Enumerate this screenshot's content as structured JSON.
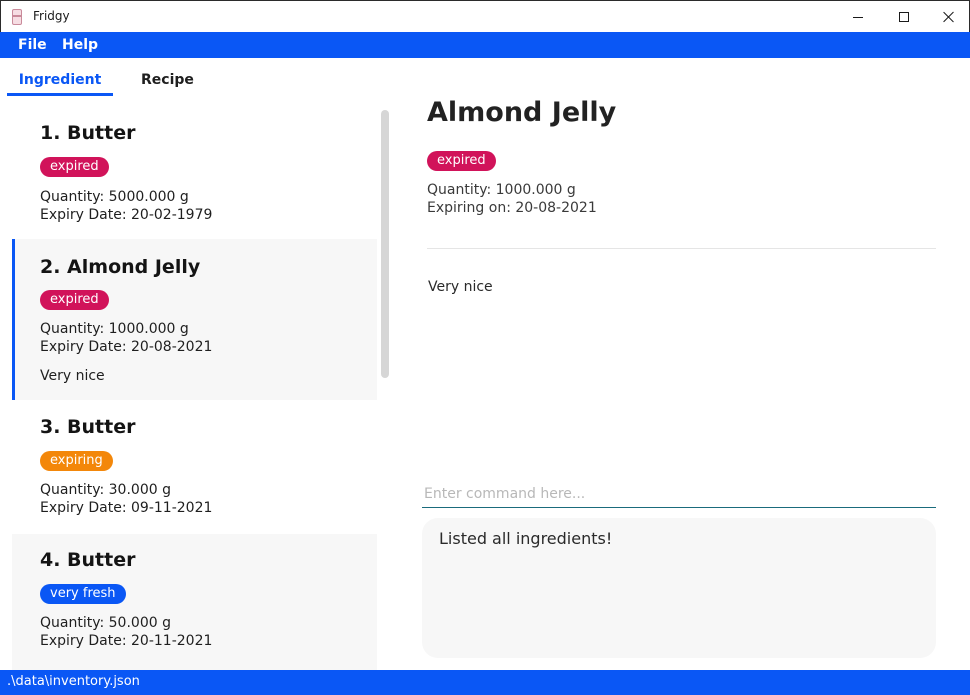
{
  "window": {
    "title": "Fridgy",
    "app_icon": "fridge-icon",
    "controls": [
      "minimize-icon",
      "maximize-icon",
      "close-icon"
    ]
  },
  "menu": {
    "file": "File",
    "help": "Help"
  },
  "tabs": {
    "ingredient": "Ingredient",
    "recipe": "Recipe",
    "active": "Ingredient"
  },
  "ingredients": [
    {
      "title": "1.  Butter",
      "status": "expired",
      "quantity": "Quantity: 5000.000 g",
      "expiry": "Expiry Date: 20-02-1979",
      "description": ""
    },
    {
      "title": "2.  Almond Jelly",
      "status": "expired",
      "quantity": "Quantity: 1000.000 g",
      "expiry": "Expiry Date: 20-08-2021",
      "description": "Very nice",
      "selected": true
    },
    {
      "title": "3.  Butter",
      "status": "expiring",
      "quantity": "Quantity: 30.000 g",
      "expiry": "Expiry Date: 09-11-2021",
      "description": ""
    },
    {
      "title": "4.  Butter",
      "status": "very fresh",
      "quantity": "Quantity: 50.000 g",
      "expiry": "Expiry Date: 20-11-2021",
      "description": ""
    }
  ],
  "detail": {
    "name": "Almond Jelly",
    "status": "expired",
    "quantity": "Quantity: 1000.000 g",
    "expiring": "Expiring on: 20-08-2021",
    "description": "Very nice"
  },
  "command": {
    "placeholder": "Enter command here...",
    "value": ""
  },
  "result": {
    "message": "Listed all ingredients!"
  },
  "status_bar": {
    "path": ".\\data\\inventory.json"
  },
  "colors": {
    "accent": "#0a57f5",
    "expired": "#d1135a",
    "expiring": "#f3870a",
    "fresh": "#0a57f5"
  }
}
